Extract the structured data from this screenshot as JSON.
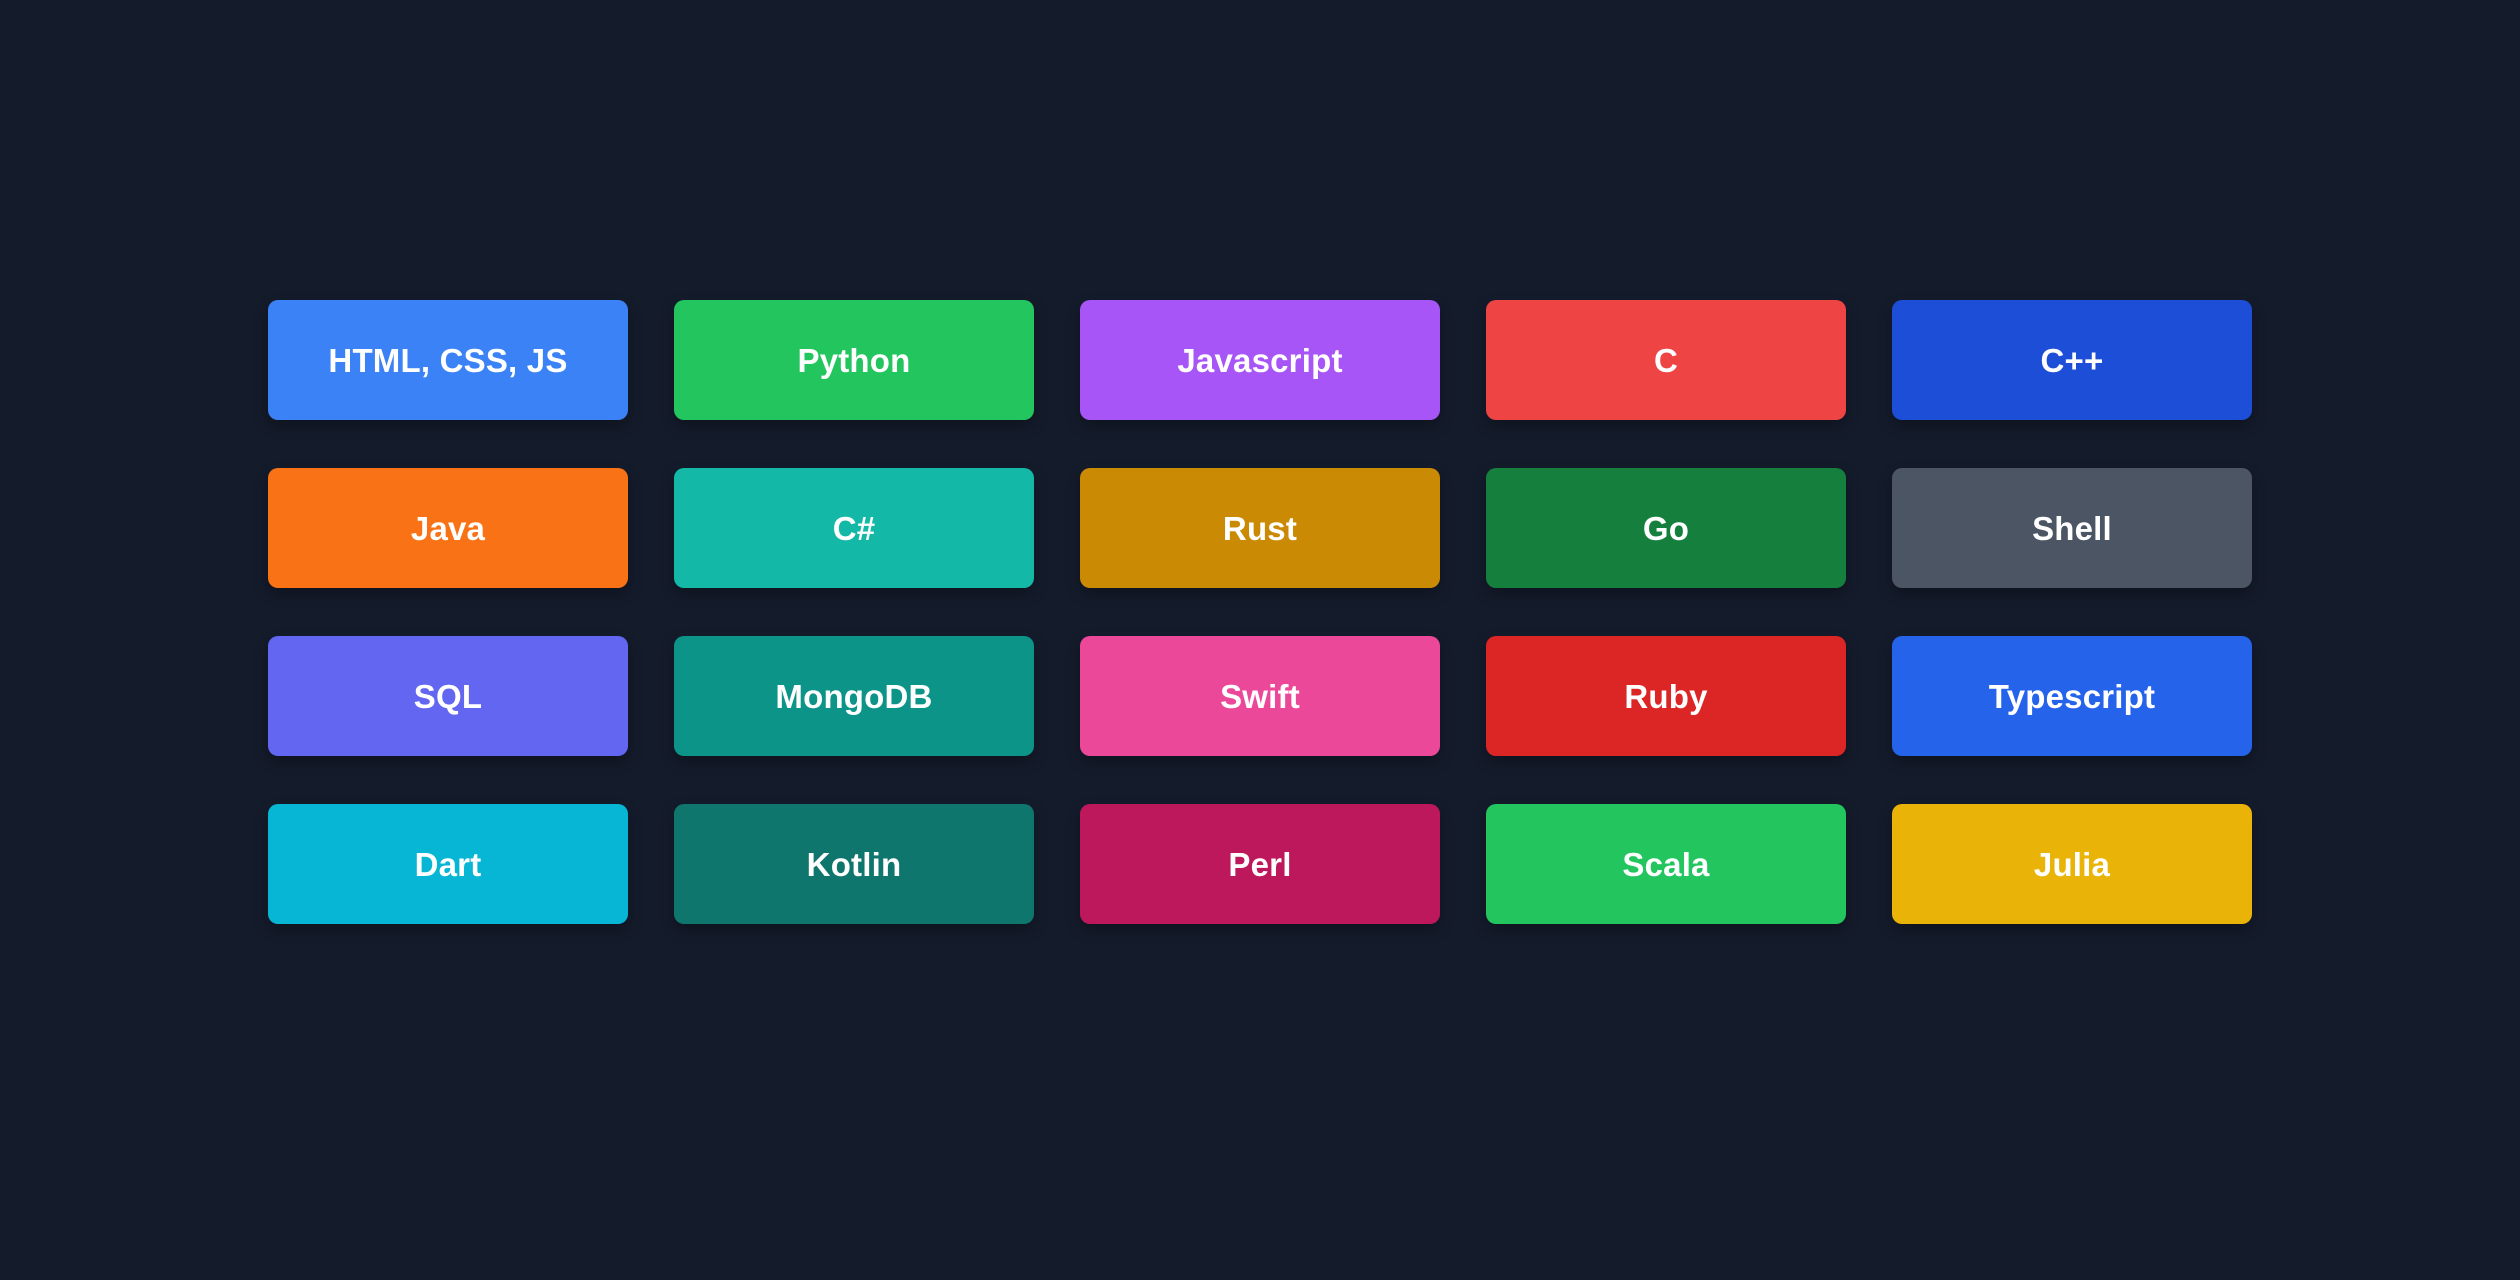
{
  "page": {
    "background_color": "#141b2b",
    "label_color": "#ffffff",
    "columns": 5,
    "rows": 4
  },
  "cards": [
    {
      "label": "HTML, CSS, JS",
      "color": "#3b82f6",
      "row": 1,
      "column": 1
    },
    {
      "label": "Python",
      "color": "#22c55e",
      "row": 1,
      "column": 2
    },
    {
      "label": "Javascript",
      "color": "#a855f7",
      "row": 1,
      "column": 3
    },
    {
      "label": "C",
      "color": "#ef4444",
      "row": 1,
      "column": 4
    },
    {
      "label": "C++",
      "color": "#1d4ed8",
      "row": 1,
      "column": 5
    },
    {
      "label": "Java",
      "color": "#f97316",
      "row": 2,
      "column": 1
    },
    {
      "label": "C#",
      "color": "#14b8a6",
      "row": 2,
      "column": 2
    },
    {
      "label": "Rust",
      "color": "#ca8a04",
      "row": 2,
      "column": 3
    },
    {
      "label": "Go",
      "color": "#15803d",
      "row": 2,
      "column": 4
    },
    {
      "label": "Shell",
      "color": "#4b5563",
      "row": 2,
      "column": 5
    },
    {
      "label": "SQL",
      "color": "#6366f1",
      "row": 3,
      "column": 1
    },
    {
      "label": "MongoDB",
      "color": "#0d9488",
      "row": 3,
      "column": 2
    },
    {
      "label": "Swift",
      "color": "#ec4899",
      "row": 3,
      "column": 3
    },
    {
      "label": "Ruby",
      "color": "#dc2626",
      "row": 3,
      "column": 4
    },
    {
      "label": "Typescript",
      "color": "#2563eb",
      "row": 3,
      "column": 5
    },
    {
      "label": "Dart",
      "color": "#06b6d4",
      "row": 4,
      "column": 1
    },
    {
      "label": "Kotlin",
      "color": "#0f766e",
      "row": 4,
      "column": 2
    },
    {
      "label": "Perl",
      "color": "#be185d",
      "row": 4,
      "column": 3
    },
    {
      "label": "Scala",
      "color": "#22c55e",
      "row": 4,
      "column": 4
    },
    {
      "label": "Julia",
      "color": "#eab308",
      "row": 4,
      "column": 5
    }
  ]
}
